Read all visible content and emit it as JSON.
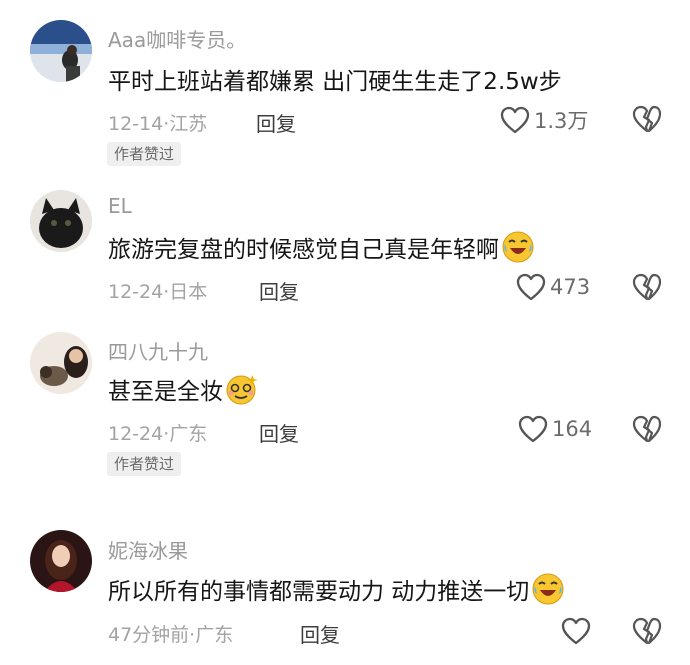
{
  "comments": [
    {
      "username": "Aaa咖啡专员。",
      "text": "平时上班站着都嫌累 出门硬生生走了2.5w步",
      "date_location": "12-14·江苏",
      "reply_label": "回复",
      "likes": "1.3万",
      "badge": "作者赞过",
      "emoji": "",
      "avatar": "scenery-person-avatar"
    },
    {
      "username": "EL",
      "text": "旅游完复盘的时候感觉自己真是年轻啊",
      "date_location": "12-24·日本",
      "reply_label": "回复",
      "likes": "473",
      "badge": "",
      "emoji": "laugh-cry-emoji",
      "avatar": "black-cat-avatar"
    },
    {
      "username": "四八九十九",
      "text": "甚至是全妆",
      "date_location": "12-24·广东",
      "reply_label": "回复",
      "likes": "164",
      "badge": "作者赞过",
      "emoji": "dizzy-emoji",
      "avatar": "person-with-dog-avatar"
    },
    {
      "username": "妮海冰果",
      "text": "所以所有的事情都需要动力 动力推送一切",
      "date_location": "47分钟前·广东",
      "reply_label": "回复",
      "likes": "",
      "badge": "",
      "emoji": "laugh-cry-emoji",
      "avatar": "woman-portrait-avatar"
    }
  ],
  "colors": {
    "username": "#9a9a9a",
    "text": "#161616",
    "meta": "#a3a3a3",
    "badge_bg": "#efefef",
    "icon_stroke": "#555555"
  }
}
